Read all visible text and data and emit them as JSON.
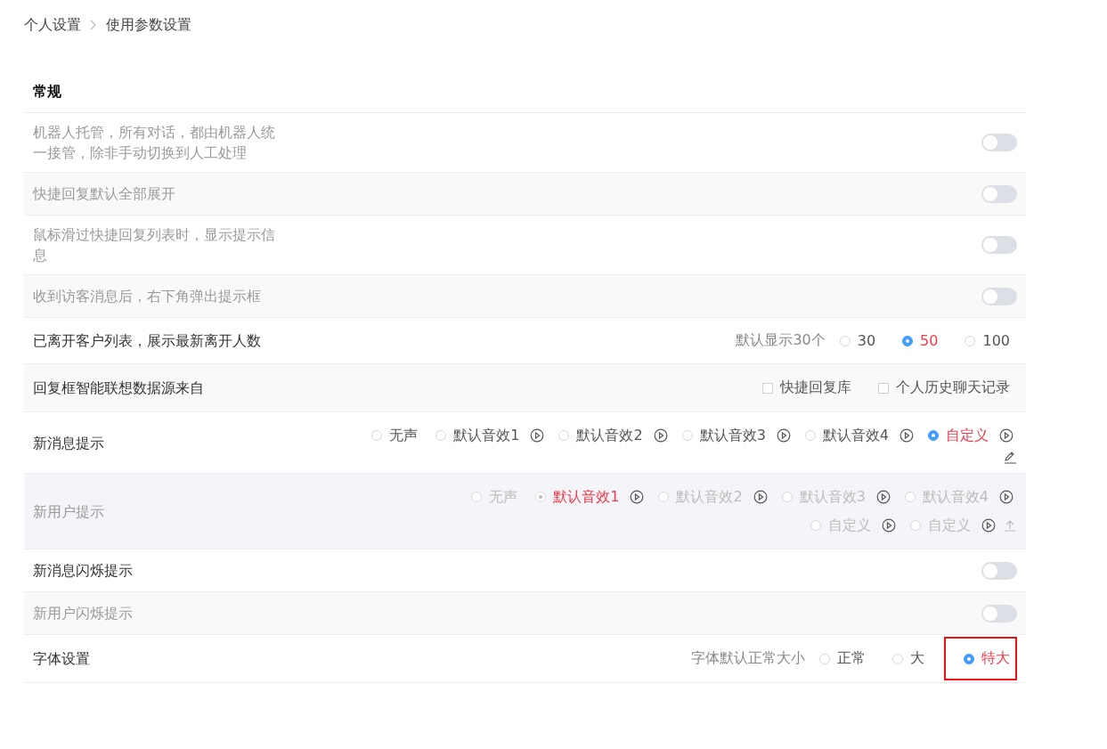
{
  "breadcrumb": [
    "个人设置",
    "使用参数设置"
  ],
  "section_title": "常规",
  "rows": [
    {
      "kind": "toggle",
      "label": "机器人托管，所有对话，都由机器人统一接管，除非手动切换到人工处理",
      "disabled": true,
      "on": false
    },
    {
      "kind": "toggle",
      "label": "快捷回复默认全部展开",
      "disabled": true,
      "on": false
    },
    {
      "kind": "toggle",
      "label": "鼠标滑过快捷回复列表时，显示提示信息",
      "disabled": true,
      "on": false
    },
    {
      "kind": "toggle",
      "label": "收到访客消息后，右下角弹出提示框",
      "disabled": true,
      "on": false
    },
    {
      "kind": "radio",
      "label": "已离开客户列表，展示最新离开人数",
      "disabled": false,
      "hint": "默认显示30个",
      "options": [
        {
          "label": "30",
          "selected": false,
          "highlighted": false
        },
        {
          "label": "50",
          "selected": true,
          "highlighted": false
        },
        {
          "label": "100",
          "selected": false,
          "highlighted": false
        }
      ]
    },
    {
      "kind": "checkbox",
      "label": "回复框智能联想数据源来自",
      "disabled": false,
      "options": [
        {
          "label": "快捷回复库",
          "checked": false
        },
        {
          "label": "个人历史聊天记录",
          "checked": false
        }
      ]
    },
    {
      "kind": "sound",
      "label": "新消息提示",
      "disabled": false,
      "lines": [
        [
          {
            "kind": "option",
            "label": "无声",
            "selected": false,
            "play": false
          },
          {
            "kind": "option",
            "label": "默认音效1",
            "selected": false,
            "play": true
          },
          {
            "kind": "option",
            "label": "默认音效2",
            "selected": false,
            "play": true
          },
          {
            "kind": "option",
            "label": "默认音效3",
            "selected": false,
            "play": true
          },
          {
            "kind": "option",
            "label": "默认音效4",
            "selected": false,
            "play": true
          },
          {
            "kind": "option",
            "label": "自定义",
            "selected": true,
            "play": true
          }
        ],
        [
          {
            "kind": "edit"
          }
        ]
      ]
    },
    {
      "kind": "sound",
      "label": "新用户提示",
      "disabled": true,
      "lines": [
        [
          {
            "kind": "option",
            "label": "无声",
            "selected": false,
            "play": false
          },
          {
            "kind": "option",
            "label": "默认音效1",
            "selected": true,
            "play": true
          },
          {
            "kind": "option",
            "label": "默认音效2",
            "selected": false,
            "play": true
          },
          {
            "kind": "option",
            "label": "默认音效3",
            "selected": false,
            "play": true
          },
          {
            "kind": "option",
            "label": "默认音效4",
            "selected": false,
            "play": true
          }
        ],
        [
          {
            "kind": "option",
            "label": "自定义",
            "selected": false,
            "play": true
          },
          {
            "kind": "option",
            "label": "自定义",
            "selected": false,
            "play": true
          },
          {
            "kind": "upload"
          }
        ]
      ]
    },
    {
      "kind": "toggle",
      "label": "新消息闪烁提示",
      "disabled": false,
      "on": false
    },
    {
      "kind": "toggle",
      "label": "新用户闪烁提示",
      "disabled": true,
      "on": false
    },
    {
      "kind": "radio",
      "label": "字体设置",
      "disabled": false,
      "hint": "字体默认正常大小",
      "options": [
        {
          "label": "正常",
          "selected": false,
          "highlighted": false
        },
        {
          "label": "大",
          "selected": false,
          "highlighted": false
        },
        {
          "label": "特大",
          "selected": true,
          "highlighted": true
        }
      ]
    }
  ]
}
